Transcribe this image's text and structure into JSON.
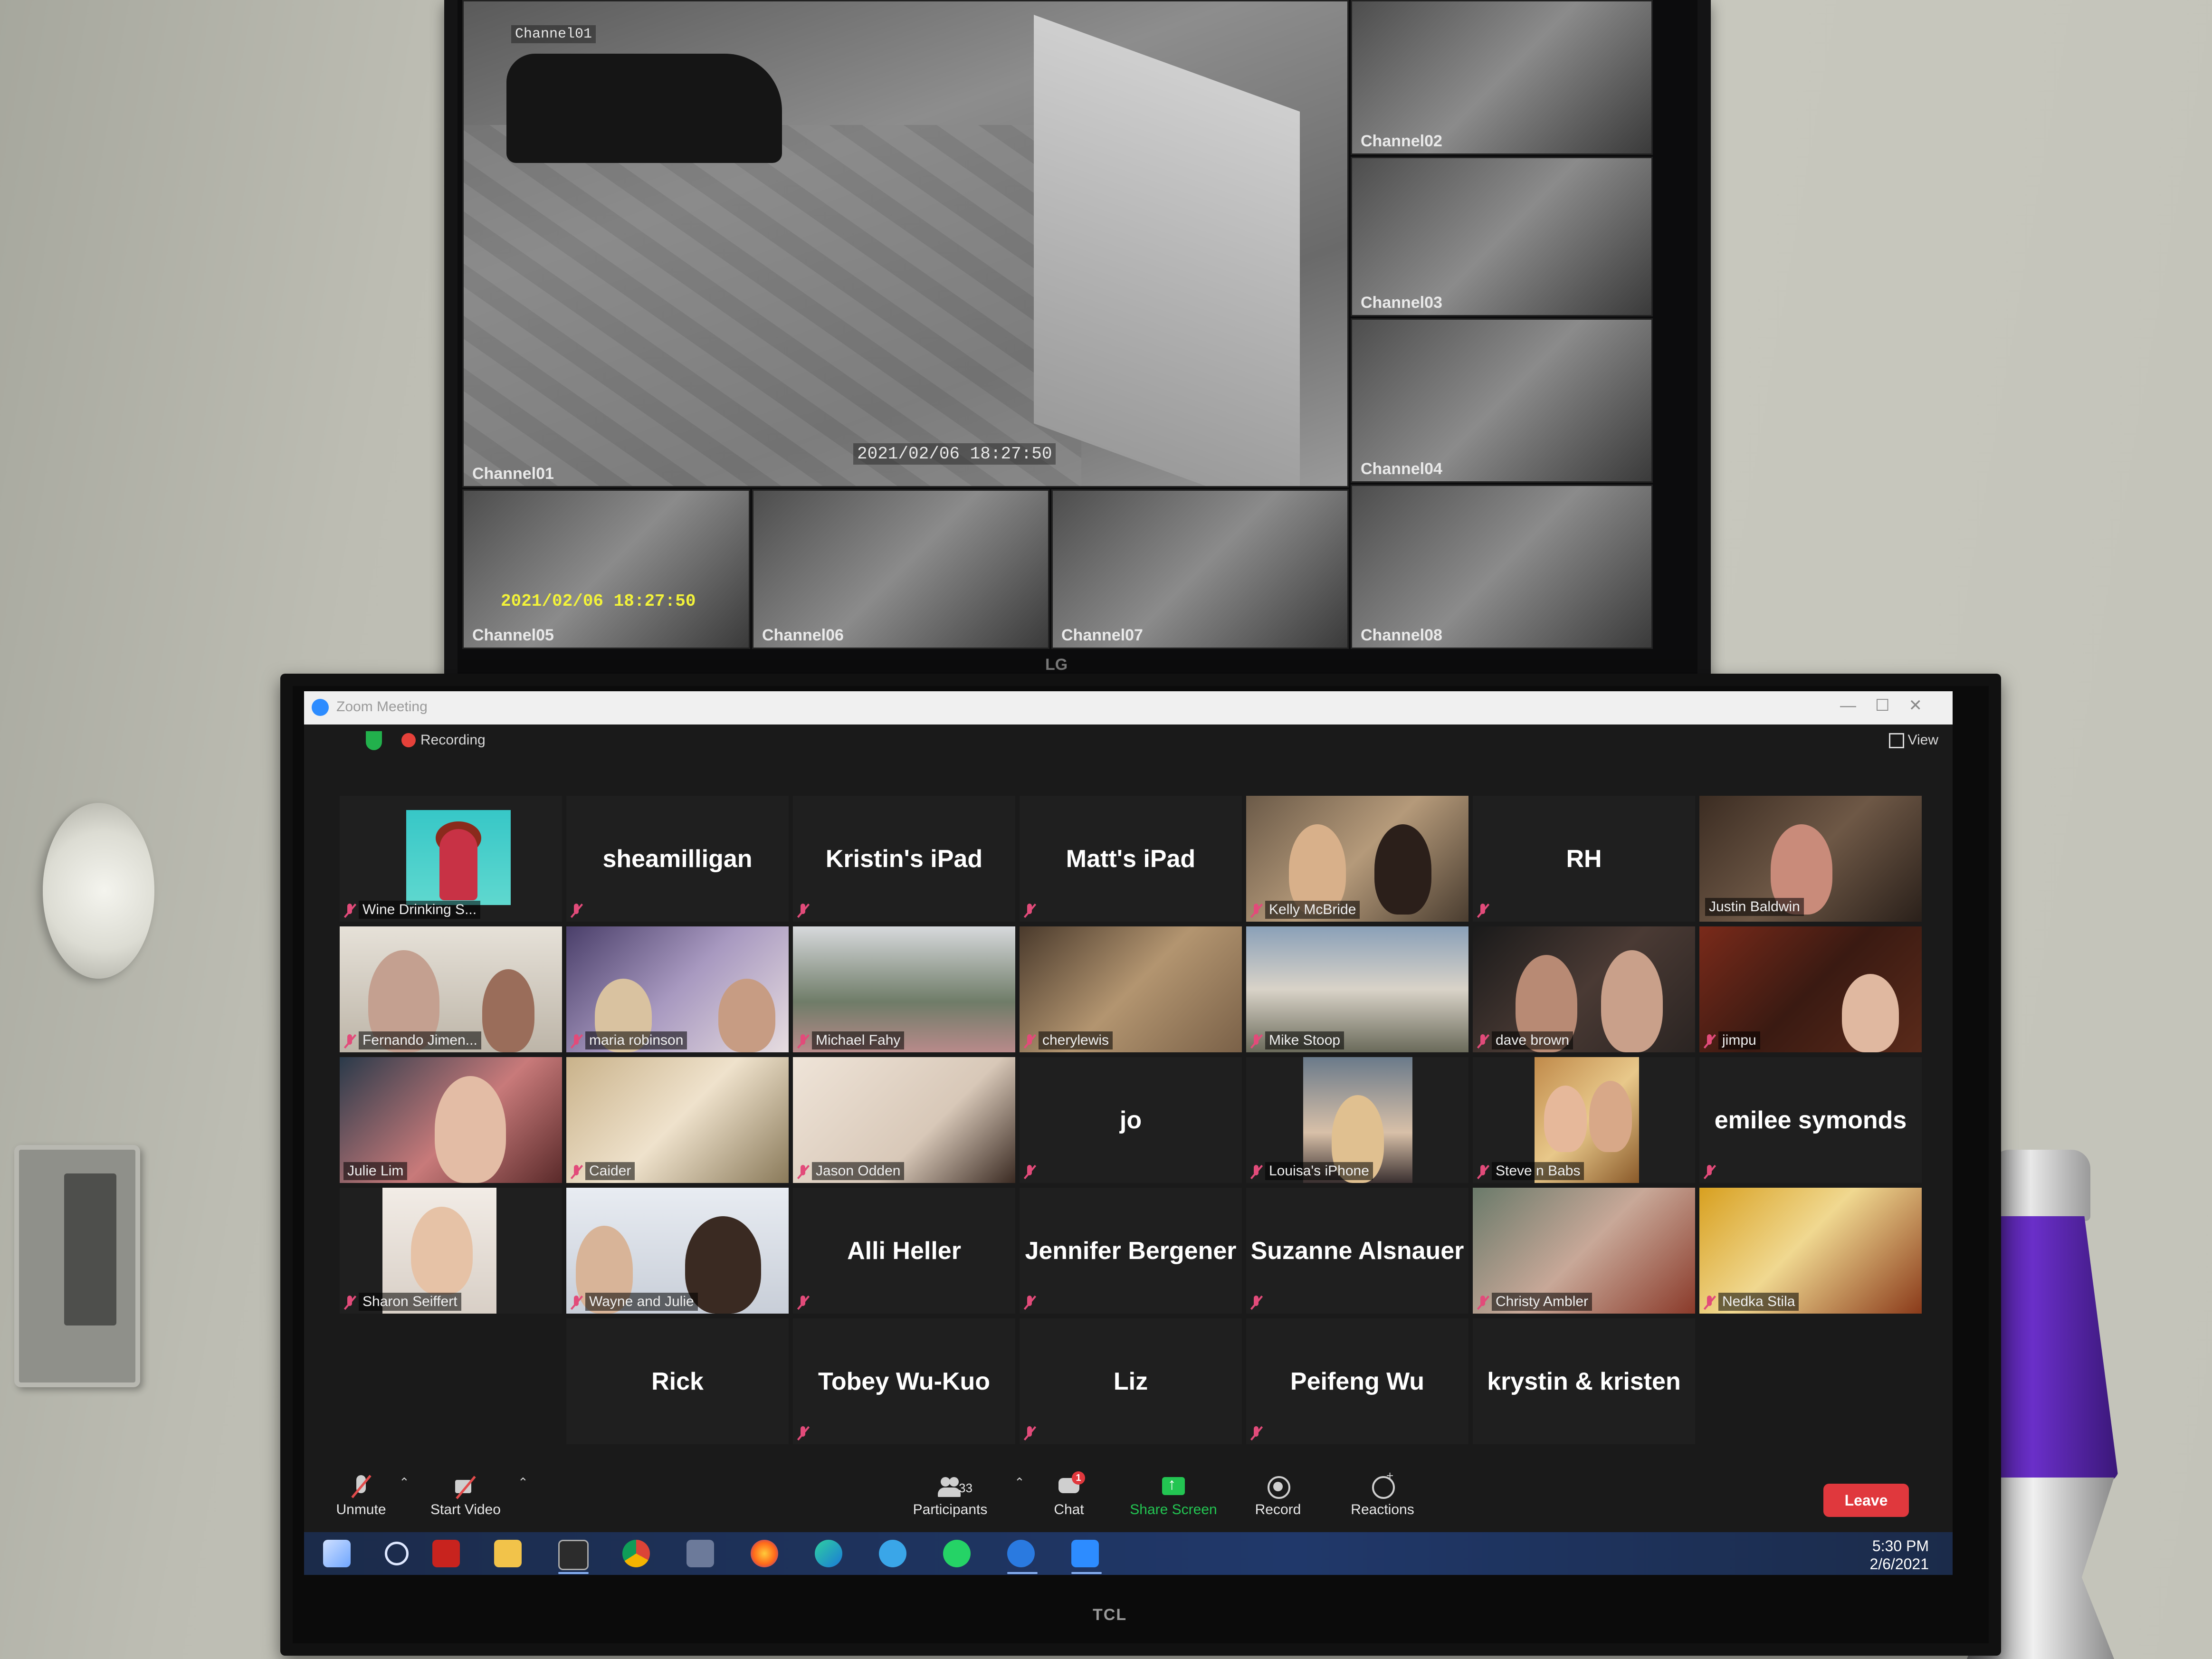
{
  "cctv": {
    "brand": "LG",
    "main_timestamp": "2021/02/06 18:27:50",
    "thumb_timestamp": "2021/02/06 18:27:50",
    "channels": [
      {
        "id": "ch01",
        "label": "Channel01"
      },
      {
        "id": "ch02",
        "label": "Channel02"
      },
      {
        "id": "ch03",
        "label": "Channel03"
      },
      {
        "id": "ch04",
        "label": "Channel04"
      },
      {
        "id": "ch05",
        "label": "Channel05"
      },
      {
        "id": "ch06",
        "label": "Channel06"
      },
      {
        "id": "ch07",
        "label": "Channel07"
      },
      {
        "id": "ch08",
        "label": "Channel08"
      }
    ],
    "main_overlay_label": "Channel01"
  },
  "tv": {
    "brand": "TCL"
  },
  "zoom": {
    "window_title": "Zoom Meeting",
    "recording_label": "Recording",
    "view_label": "View",
    "participants": [
      "Wine Drinking S...",
      "sheamilligan",
      "Kristin's iPad",
      "Matt's iPad",
      "Kelly McBride",
      "RH",
      "Justin Baldwin",
      "Fernando Jimen...",
      "maria robinson",
      "Michael Fahy",
      "cherylewis",
      "Mike Stoop",
      "dave brown",
      "jimpu",
      "Julie Lim",
      "Caider",
      "Jason Odden",
      "jo",
      "Louisa's iPhone",
      "Steve n Babs",
      "emilee symonds",
      "Sharon Seiffert",
      "Wayne and Julie",
      "Alli Heller",
      "Jennifer Bergener",
      "Suzanne Alsnauer",
      "Christy Ambler",
      "Nedka Stila",
      "Rick",
      "Tobey Wu-Kuo",
      "Liz",
      "Peifeng Wu",
      "krystin & kristen"
    ],
    "toolbar": {
      "unmute": "Unmute",
      "start_video": "Start Video",
      "participants": "Participants",
      "participant_count": "33",
      "chat": "Chat",
      "chat_badge": "1",
      "share_screen": "Share Screen",
      "record": "Record",
      "reactions": "Reactions",
      "leave": "Leave"
    },
    "taskbar": {
      "time": "5:30 PM",
      "date": "2/6/2021",
      "apps": [
        "windows-start",
        "search",
        "filezilla",
        "file-explorer",
        "terminal",
        "chrome",
        "calculator",
        "firefox",
        "edge",
        "cortana",
        "whatsapp",
        "browser",
        "zoom"
      ]
    },
    "colors": {
      "accent_green": "#23c552",
      "leave_red": "#e0383d",
      "active_speaker": "#d6ea27",
      "muted_pink": "#e24b7a"
    }
  }
}
